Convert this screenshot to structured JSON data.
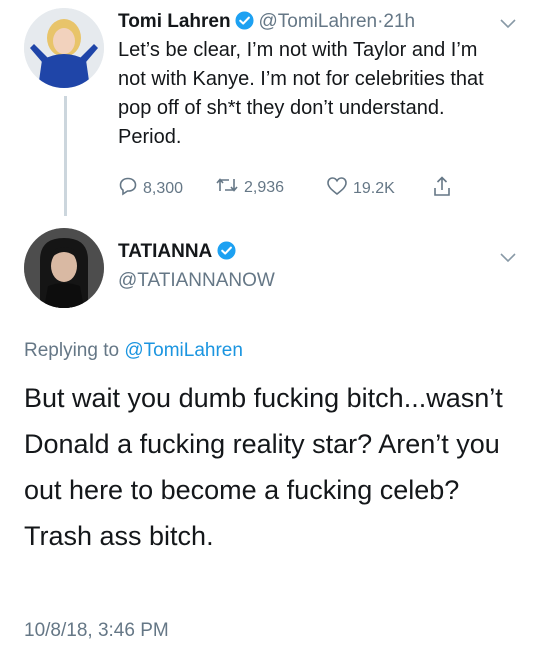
{
  "tweet1": {
    "name": "Tomi Lahren",
    "handle": "@TomiLahren",
    "separator": "·",
    "time": "21h",
    "text": "Let’s be clear, I’m not with Taylor and I’m not with Kanye. I’m not for celebrities that pop off of sh*t they don’t understand. Period.",
    "replies": "8,300",
    "retweets": "2,936",
    "likes": "19.2K"
  },
  "tweet2": {
    "name": "TATIANNA",
    "handle": "@TATIANNANOW",
    "replying_prefix": "Replying to",
    "replying_handle": "@TomiLahren",
    "text": "But wait you dumb fucking bitch...wasn’t Donald a fucking reality star? Aren’t you out here to become a fucking celeb? Trash ass bitch.",
    "timestamp": "10/8/18, 3:46 PM"
  },
  "colors": {
    "verified": "#1da1f2",
    "link": "#1b95e0",
    "secondary_text": "#657786",
    "thread_line": "#ccd6dd"
  }
}
